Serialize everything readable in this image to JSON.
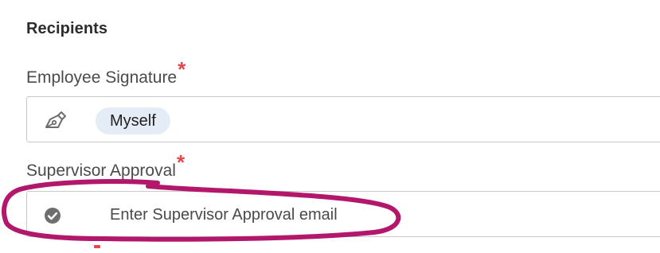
{
  "recipients": {
    "title": "Recipients",
    "employee_signature": {
      "label": "Employee Signature",
      "required_mark": "*",
      "icon": "pen-icon",
      "chip_label": "Myself"
    },
    "supervisor_approval": {
      "label": "Supervisor Approval",
      "required_mark": "*",
      "icon": "check-circle-icon",
      "placeholder": "Enter Supervisor Approval email",
      "value": ""
    }
  },
  "colors": {
    "required": "#e34850",
    "chip_bg": "#e4ecf5",
    "annotation": "#b3176b"
  },
  "annotation": {
    "type": "hand-drawn-circle",
    "target": "supervisor-approval-field"
  }
}
